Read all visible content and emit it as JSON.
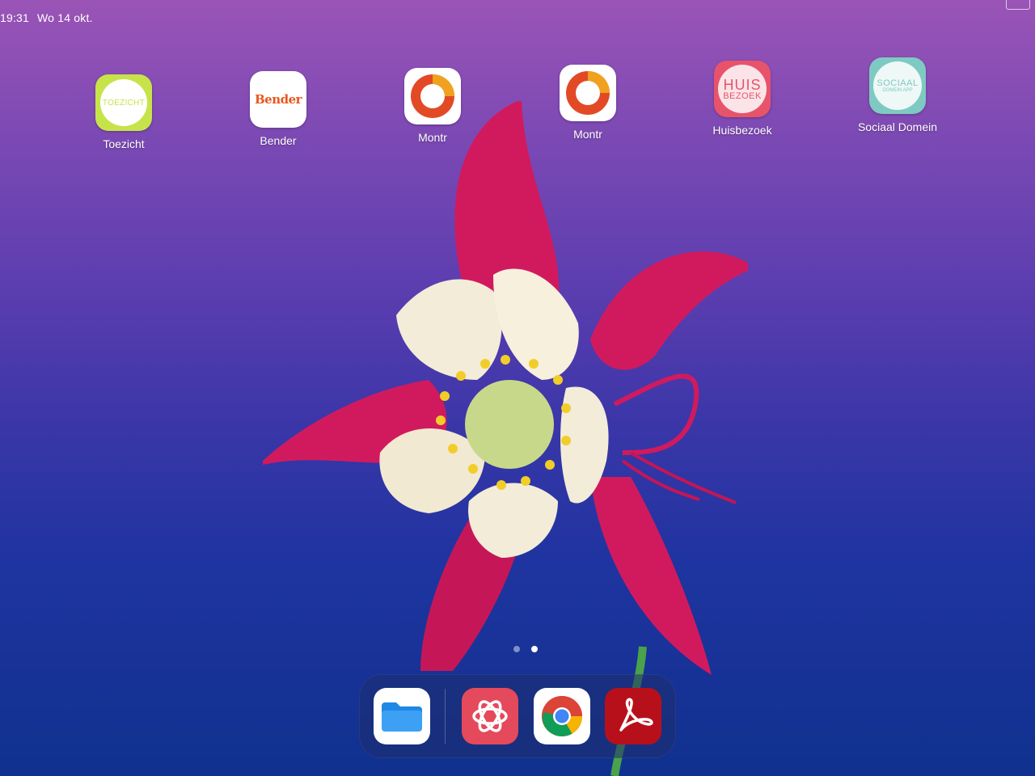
{
  "status_bar": {
    "time": "19:31",
    "date": "Wo 14 okt."
  },
  "home_apps": [
    {
      "label": "Toezicht",
      "icon": "toezicht-app-icon",
      "icon_text": "TOEZICHT"
    },
    {
      "label": "Bender",
      "icon": "bender-app-icon",
      "icon_text": "Bender"
    },
    {
      "label": "Montr",
      "icon": "montr-app-icon"
    },
    {
      "label": "Montr",
      "icon": "montr-app-icon"
    },
    {
      "label": "Huisbezoek",
      "icon": "huisbezoek-app-icon",
      "icon_text_1": "HUIS",
      "icon_text_2": "BEZOEK"
    },
    {
      "label": "Sociaal Domein",
      "icon": "sociaal-domein-app-icon",
      "icon_text_1": "SOCIAAL",
      "icon_text_2": "DOMEIN APP"
    }
  ],
  "page_indicator": {
    "pages": 2,
    "current": 2
  },
  "dock": [
    {
      "icon": "files-icon"
    },
    {
      "icon": "openai-icon"
    },
    {
      "icon": "chrome-icon"
    },
    {
      "icon": "acrobat-icon"
    }
  ],
  "colors": {
    "toezicht": "#c7e34a",
    "bender": "#e8571d",
    "montr_red": "#e24a25",
    "huisbezoek": "#e8536c",
    "sociaal": "#7fc9c3",
    "dock_openai": "#e5495c",
    "dock_acrobat": "#b8101b"
  }
}
